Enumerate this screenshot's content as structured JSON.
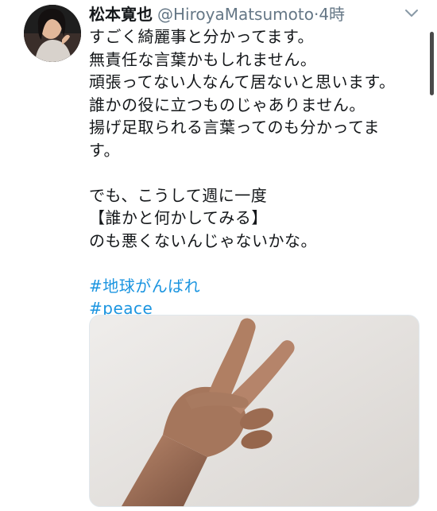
{
  "tweet": {
    "display_name": "松本寛也",
    "handle": "@HiroyaMatsumoto",
    "separator": "·",
    "time": "4時",
    "lines": [
      "すごく綺麗事と分かってます。",
      "無責任な言葉かもしれません。",
      "頑張ってない人なんて居ないと思います。",
      "誰かの役に立つものじゃありません。",
      "揚げ足取られる言葉ってのも分かってま",
      "す。"
    ],
    "lines2": [
      "でも、こうして週に一度",
      "【誰かと何かしてみる】",
      "のも悪くないんじゃないかな。"
    ],
    "hashtags": [
      "#地球がんばれ",
      "#peace"
    ]
  },
  "icons": {
    "menu": "chevron-down-icon"
  },
  "colors": {
    "text": "#14171a",
    "secondary": "#657786",
    "link": "#1b95e0"
  }
}
